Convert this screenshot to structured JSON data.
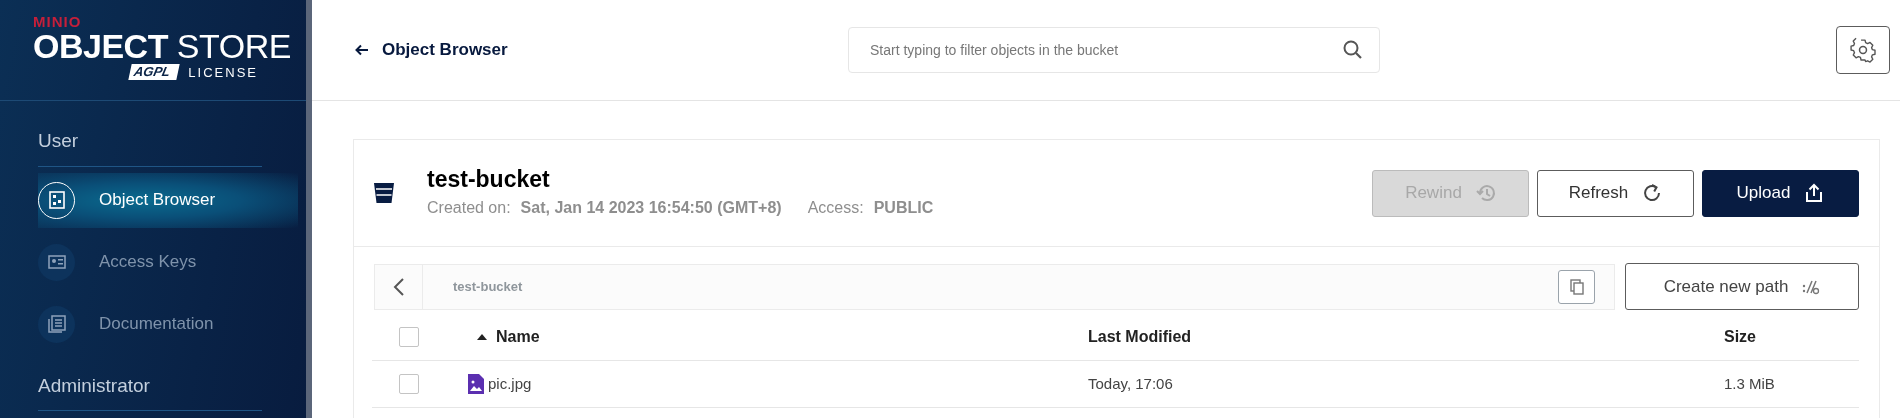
{
  "sidebar": {
    "logo": {
      "brand": "MINIO",
      "product_bold": "OBJECT",
      "product_light": "STORE",
      "license_badge": "AGPL",
      "license": "LICENSE"
    },
    "sections": [
      {
        "title": "User",
        "items": [
          {
            "label": "Object Browser",
            "selected": true
          },
          {
            "label": "Access Keys",
            "selected": false
          },
          {
            "label": "Documentation",
            "selected": false
          }
        ]
      },
      {
        "title": "Administrator"
      }
    ]
  },
  "header": {
    "title": "Object Browser",
    "search": {
      "placeholder": "Start typing to filter objects in the bucket"
    }
  },
  "bucket": {
    "name": "test-bucket",
    "created_label": "Created on:",
    "created": "Sat, Jan 14 2023 16:54:50 (GMT+8)",
    "access_label": "Access:",
    "access": "PUBLIC",
    "buttons": [
      {
        "label": "Rewind",
        "kind": "rewind",
        "disabled": true
      },
      {
        "label": "Refresh",
        "kind": "refresh",
        "disabled": false
      },
      {
        "label": "Upload",
        "kind": "upload",
        "disabled": false
      }
    ]
  },
  "breadcrumb": {
    "path": "test-bucket"
  },
  "create_path_button": "Create new path",
  "table": {
    "select_all_checked": false,
    "columns": [
      {
        "label": "Name",
        "sorted": true
      },
      {
        "label": "Last Modified",
        "sorted": false
      },
      {
        "label": "Size",
        "sorted": false
      }
    ],
    "rows": [
      {
        "name": "pic.jpg",
        "last_modified": "Today, 17:06",
        "size": "1.3 MiB",
        "checked": false
      }
    ]
  }
}
